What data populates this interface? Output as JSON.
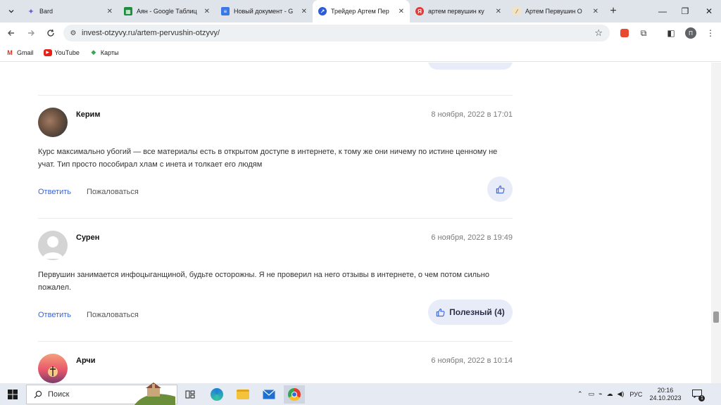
{
  "browser": {
    "tabs": [
      {
        "title": "Bard",
        "favicon": "bard-icon",
        "color": "#6b5de0"
      },
      {
        "title": "Аян - Google Таблиц",
        "favicon": "sheets-icon",
        "color": "#1e8e3e"
      },
      {
        "title": "Новый документ - G",
        "favicon": "docs-icon",
        "color": "#3b78e7"
      },
      {
        "title": "Трейдер Артем Пер",
        "favicon": "site-icon",
        "color": "#2e5bd6",
        "active": true
      },
      {
        "title": "артем первушин ку",
        "favicon": "yandex-icon",
        "color": "#e53935"
      },
      {
        "title": "Артем Первушин О",
        "favicon": "page-icon",
        "color": "#c8a96a"
      }
    ],
    "url": "invest-otzyvy.ru/artem-pervushin-otzyvy/",
    "profile_initial": "П",
    "bookmarks": [
      {
        "label": "Gmail",
        "icon": "gmail-icon"
      },
      {
        "label": "YouTube",
        "icon": "youtube-icon"
      },
      {
        "label": "Карты",
        "icon": "maps-icon"
      }
    ]
  },
  "comments": [
    {
      "author": "Керим",
      "date": "8 ноября, 2022 в 17:01",
      "text": "Курс максимально убогий — все материалы есть в открытом доступе в интернете, к тому же они ничему по истине ценному не учат. Тип просто пособирал хлам с инета и толкает его людям",
      "reply_label": "Ответить",
      "report_label": "Пожаловаться",
      "like_label": ""
    },
    {
      "author": "Сурен",
      "date": "6 ноября, 2022 в 19:49",
      "text": "Первушин занимается инфоцыганщиной, будьте осторожны. Я не проверил на него отзывы в интернете, о чем потом сильно пожалел.",
      "reply_label": "Ответить",
      "report_label": "Пожаловаться",
      "like_label": "Полезный (4)"
    },
    {
      "author": "Арчи",
      "date": "6 ноября, 2022 в 10:14"
    }
  ],
  "taskbar": {
    "search_placeholder": "Поиск",
    "language": "РУС",
    "time": "20:16",
    "date": "24.10.2023",
    "notifications": "1"
  },
  "colors": {
    "accent_link": "#3a64d8",
    "like_bg": "#e8ebf8"
  }
}
